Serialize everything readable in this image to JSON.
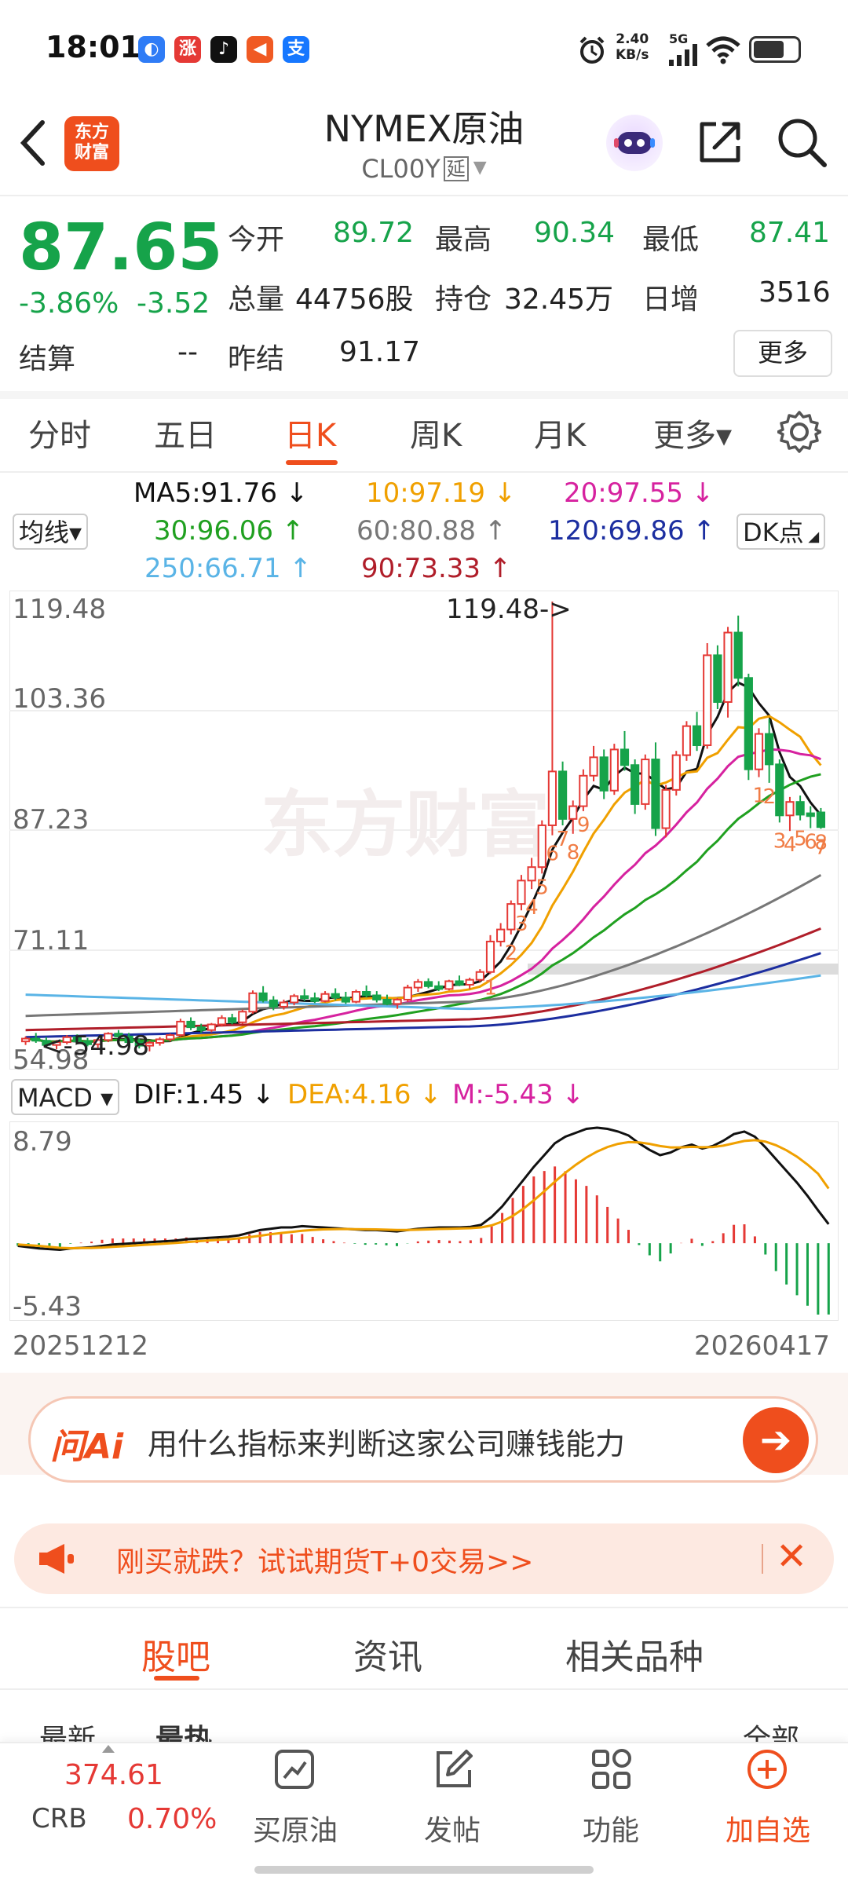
{
  "status_bar": {
    "time": "18:01",
    "app_icons": [
      "blue-app-icon",
      "zhang-app-icon",
      "tiktok-icon",
      "orange-app-icon",
      "alipay-icon"
    ],
    "app_icon_glyphs": [
      "◐",
      "涨",
      "♪",
      "◀",
      "支"
    ],
    "alarm_icon": "alarm-clock-icon",
    "net_speed": "2.40",
    "net_unit": "KB/s",
    "network": "5G",
    "wifi_icon": "wifi-icon",
    "battery_icon": "battery-icon"
  },
  "header": {
    "back_icon": "chevron-left-icon",
    "logo_text_line1": "东方",
    "logo_text_line2": "财富",
    "title": "NYMEX原油",
    "code": "CL00Y",
    "delay_badge": "延",
    "share_icon": "share-icon",
    "search_icon": "search-icon"
  },
  "quote": {
    "price": "87.65",
    "change_pct": "-3.86%",
    "change": "-3.52",
    "open_label": "今开",
    "open": "89.72",
    "high_label": "最高",
    "high": "90.34",
    "low_label": "最低",
    "low": "87.41",
    "volume_label": "总量",
    "volume": "44756股",
    "oi_label": "持仓",
    "oi": "32.45万",
    "daily_inc_label": "日增",
    "daily_inc": "3516",
    "settle_label": "结算",
    "settle": "--",
    "prev_settle_label": "昨结",
    "prev_settle": "91.17",
    "more_label": "更多"
  },
  "kline_tabs": {
    "items": [
      "分时",
      "五日",
      "日K",
      "周K",
      "月K",
      "更多▾"
    ],
    "active": "日K",
    "settings_icon": "gear-icon"
  },
  "ma": {
    "selector": "均线▾",
    "dk_button": "DK点",
    "ma5": "MA5:91.76 ↓",
    "ma10": "10:97.19 ↓",
    "ma20": "20:97.55 ↓",
    "ma30": "30:96.06 ↑",
    "ma60": "60:80.88 ↑",
    "ma120": "120:69.86 ↑",
    "ma250": "250:66.71 ↑",
    "ma90": "90:73.33 ↑",
    "colors": {
      "ma5": "#111111",
      "ma10": "#f0a000",
      "ma20": "#d6229f",
      "ma30": "#20a020",
      "ma60": "#777777",
      "ma120": "#1c2ea0",
      "ma250": "#5ab4e6",
      "ma90": "#b01e2a"
    }
  },
  "chart_data": [
    {
      "type": "candlestick",
      "y_ticks": [
        "119.48",
        "103.36",
        "87.23",
        "71.11",
        "54.98"
      ],
      "ylim": [
        54.98,
        119.48
      ],
      "max_annotation": "119.48->",
      "min_annotation": "<-54.98",
      "watermark": "东方财富",
      "x_start_label": "20251212",
      "x_end_label": "20260417",
      "candles": [
        [
          57.4,
          58.1,
          56.9,
          57.8
        ],
        [
          57.8,
          58.6,
          57.2,
          57.5
        ],
        [
          57.5,
          58.0,
          56.6,
          56.9
        ],
        [
          56.9,
          57.6,
          56.3,
          57.3
        ],
        [
          57.3,
          58.3,
          57.0,
          58.0
        ],
        [
          58.0,
          58.4,
          57.1,
          57.4
        ],
        [
          57.4,
          57.9,
          56.7,
          57.0
        ],
        [
          57.0,
          57.8,
          56.5,
          57.6
        ],
        [
          57.6,
          58.7,
          57.3,
          58.5
        ],
        [
          58.5,
          59.0,
          57.8,
          58.1
        ],
        [
          58.1,
          58.6,
          57.0,
          57.3
        ],
        [
          57.3,
          57.8,
          56.4,
          56.8
        ],
        [
          56.8,
          57.5,
          56.0,
          57.2
        ],
        [
          57.2,
          58.0,
          56.8,
          57.7
        ],
        [
          57.7,
          58.5,
          57.4,
          58.3
        ],
        [
          58.3,
          60.6,
          58.1,
          60.2
        ],
        [
          60.2,
          60.8,
          59.0,
          59.4
        ],
        [
          59.4,
          59.9,
          58.6,
          59.0
        ],
        [
          59.0,
          60.0,
          58.7,
          59.8
        ],
        [
          59.8,
          61.1,
          59.5,
          60.7
        ],
        [
          60.7,
          61.3,
          59.8,
          60.1
        ],
        [
          60.1,
          61.9,
          59.9,
          61.6
        ],
        [
          61.6,
          64.6,
          61.3,
          64.2
        ],
        [
          64.2,
          65.2,
          62.9,
          63.2
        ],
        [
          63.2,
          63.8,
          61.8,
          62.3
        ],
        [
          62.3,
          63.3,
          61.9,
          62.9
        ],
        [
          62.9,
          64.1,
          62.5,
          63.8
        ],
        [
          63.8,
          64.8,
          63.1,
          63.5
        ],
        [
          63.5,
          64.3,
          62.8,
          63.1
        ],
        [
          63.1,
          64.5,
          62.9,
          64.1
        ],
        [
          64.1,
          64.9,
          63.2,
          63.6
        ],
        [
          63.6,
          64.4,
          62.7,
          63.0
        ],
        [
          63.0,
          64.7,
          62.8,
          64.4
        ],
        [
          64.4,
          65.3,
          63.6,
          63.9
        ],
        [
          63.9,
          64.5,
          62.9,
          63.3
        ],
        [
          63.3,
          64.0,
          62.5,
          62.7
        ],
        [
          62.7,
          63.5,
          62.0,
          63.3
        ],
        [
          63.3,
          65.4,
          63.0,
          65.0
        ],
        [
          65.0,
          66.2,
          64.4,
          65.8
        ],
        [
          65.8,
          66.3,
          64.9,
          65.2
        ],
        [
          65.2,
          65.9,
          64.5,
          64.8
        ],
        [
          64.8,
          66.1,
          64.6,
          65.9
        ],
        [
          65.9,
          66.7,
          65.2,
          65.4
        ],
        [
          65.4,
          66.4,
          64.8,
          66.1
        ],
        [
          66.1,
          67.6,
          65.8,
          67.2
        ],
        [
          67.2,
          72.4,
          66.9,
          71.5
        ],
        [
          71.5,
          74.1,
          70.8,
          73.2
        ],
        [
          73.2,
          77.3,
          72.5,
          76.8
        ],
        [
          76.8,
          80.9,
          75.9,
          80.1
        ],
        [
          80.1,
          83.3,
          78.9,
          82.0
        ],
        [
          82.0,
          88.6,
          81.1,
          87.9
        ],
        [
          87.9,
          119.48,
          86.5,
          95.5
        ],
        [
          95.5,
          96.9,
          87.9,
          88.8
        ],
        [
          88.8,
          91.4,
          86.7,
          90.6
        ],
        [
          90.6,
          95.8,
          89.9,
          94.9
        ],
        [
          94.9,
          99.1,
          94.1,
          97.5
        ],
        [
          97.5,
          98.6,
          91.6,
          92.8
        ],
        [
          92.8,
          99.4,
          92.2,
          98.6
        ],
        [
          98.6,
          101.2,
          95.6,
          96.4
        ],
        [
          96.4,
          97.2,
          89.5,
          90.9
        ],
        [
          90.9,
          97.9,
          90.1,
          97.2
        ],
        [
          97.2,
          99.6,
          86.4,
          87.5
        ],
        [
          87.5,
          93.6,
          86.2,
          92.9
        ],
        [
          92.9,
          98.4,
          92.1,
          97.8
        ],
        [
          97.8,
          102.6,
          97.0,
          101.9
        ],
        [
          101.9,
          103.9,
          98.4,
          99.2
        ],
        [
          99.2,
          113.6,
          98.7,
          111.9
        ],
        [
          111.9,
          113.3,
          104.3,
          105.3
        ],
        [
          105.3,
          115.9,
          103.1,
          115.1
        ],
        [
          115.1,
          117.5,
          107.5,
          108.7
        ],
        [
          108.7,
          109.3,
          94.3,
          95.8
        ],
        [
          95.8,
          101.6,
          94.7,
          100.8
        ],
        [
          100.8,
          102.9,
          93.9,
          96.5
        ],
        [
          96.5,
          97.2,
          88.3,
          89.3
        ],
        [
          89.3,
          91.9,
          87.1,
          91.2
        ],
        [
          91.2,
          92.1,
          88.6,
          89.4
        ],
        [
          89.6,
          90.6,
          87.5,
          89.2
        ],
        [
          89.72,
          90.34,
          87.41,
          87.65
        ]
      ],
      "markers": [
        "1",
        "2",
        "3",
        "4",
        "5",
        "6",
        "7",
        "8",
        "9",
        "1",
        "2",
        "3",
        "4",
        "5",
        "6",
        "7",
        "8"
      ]
    },
    {
      "type": "macd",
      "selector": "MACD ▾",
      "dif_label": "DIF:1.45 ↓",
      "dea_label": "DEA:4.16 ↓",
      "m_label": "M:-5.43 ↓",
      "y_top": "8.79",
      "y_bottom": "-5.43",
      "ylim": [
        -5.43,
        8.79
      ],
      "dif": [
        -0.2,
        -0.3,
        -0.4,
        -0.45,
        -0.5,
        -0.4,
        -0.35,
        -0.3,
        -0.2,
        -0.1,
        -0.05,
        0,
        0.05,
        0.1,
        0.15,
        0.2,
        0.3,
        0.35,
        0.4,
        0.45,
        0.5,
        0.6,
        0.8,
        1.0,
        1.1,
        1.2,
        1.2,
        1.3,
        1.25,
        1.2,
        1.15,
        1.1,
        1.05,
        1.0,
        1.0,
        0.95,
        0.9,
        1.0,
        1.1,
        1.15,
        1.2,
        1.2,
        1.2,
        1.25,
        1.4,
        2.0,
        2.8,
        3.8,
        4.8,
        5.8,
        6.7,
        7.6,
        8.1,
        8.4,
        8.7,
        8.79,
        8.7,
        8.5,
        8.2,
        7.6,
        7.1,
        6.7,
        6.9,
        7.3,
        7.5,
        7.2,
        7.4,
        7.8,
        8.3,
        8.5,
        8.1,
        7.3,
        6.4,
        5.5,
        4.6,
        3.6,
        2.5,
        1.45
      ],
      "dea": [
        -0.1,
        -0.15,
        -0.2,
        -0.28,
        -0.35,
        -0.38,
        -0.37,
        -0.36,
        -0.33,
        -0.28,
        -0.23,
        -0.18,
        -0.13,
        -0.08,
        -0.03,
        0.02,
        0.08,
        0.14,
        0.2,
        0.25,
        0.3,
        0.37,
        0.46,
        0.57,
        0.68,
        0.78,
        0.86,
        0.95,
        1.01,
        1.05,
        1.07,
        1.08,
        1.07,
        1.06,
        1.05,
        1.03,
        1.01,
        1.01,
        1.03,
        1.05,
        1.08,
        1.1,
        1.12,
        1.14,
        1.2,
        1.36,
        1.65,
        2.08,
        2.62,
        3.26,
        3.95,
        4.68,
        5.36,
        5.97,
        6.52,
        6.97,
        7.32,
        7.56,
        7.69,
        7.67,
        7.56,
        7.39,
        7.29,
        7.29,
        7.33,
        7.3,
        7.32,
        7.42,
        7.6,
        7.78,
        7.84,
        7.73,
        7.46,
        7.07,
        6.58,
        5.98,
        5.29,
        4.16
      ]
    }
  ],
  "ai_bar": {
    "logo": "问Ai",
    "text": "用什么指标来判断这家公司赚钱能力",
    "go_icon": "arrow-right-icon"
  },
  "promo": {
    "icon": "megaphone-icon",
    "text": "刚买就跌？试试期货T+0交易>>",
    "close_icon": "close-icon"
  },
  "community_tabs": {
    "items": [
      "股吧",
      "资讯",
      "相关品种"
    ],
    "active": "股吧"
  },
  "feed_peek": {
    "latest": "最新",
    "hot": "最热",
    "all": "全部"
  },
  "bottom_nav": {
    "crb_value": "374.61",
    "crb_label": "CRB",
    "crb_pct": "0.70%",
    "items": [
      "买原油",
      "发帖",
      "功能",
      "加自选"
    ],
    "icons": [
      "chart-buy-icon",
      "edit-icon",
      "grid-icon",
      "add-circle-icon"
    ]
  }
}
